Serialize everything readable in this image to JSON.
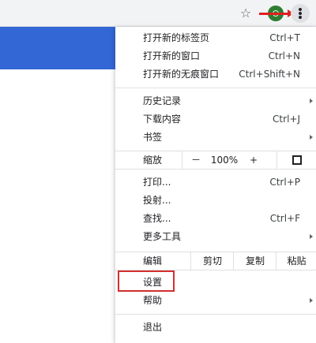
{
  "toolbar": {
    "star_icon": "star-icon",
    "menu_icon": "three-dot-menu-icon"
  },
  "colors": {
    "annotation": "#e02020",
    "page_accent": "#3367d6",
    "avatar": "#2e7d32"
  },
  "menu": {
    "new_tab": {
      "label": "打开新的标签页",
      "shortcut": "Ctrl+T"
    },
    "new_window": {
      "label": "打开新的窗口",
      "shortcut": "Ctrl+N"
    },
    "new_incognito": {
      "label": "打开新的无痕窗口",
      "shortcut": "Ctrl+Shift+N"
    },
    "history": {
      "label": "历史记录"
    },
    "downloads": {
      "label": "下载内容",
      "shortcut": "Ctrl+J"
    },
    "bookmarks": {
      "label": "书签"
    },
    "zoom": {
      "label": "缩放",
      "minus": "－",
      "value": "100%",
      "plus": "+"
    },
    "print": {
      "label": "打印...",
      "shortcut": "Ctrl+P"
    },
    "cast": {
      "label": "投射..."
    },
    "find": {
      "label": "查找...",
      "shortcut": "Ctrl+F"
    },
    "more_tools": {
      "label": "更多工具"
    },
    "edit": {
      "label": "编辑",
      "cut": "剪切",
      "copy": "复制",
      "paste": "粘贴"
    },
    "settings": {
      "label": "设置"
    },
    "help": {
      "label": "帮助"
    },
    "exit": {
      "label": "退出"
    }
  }
}
